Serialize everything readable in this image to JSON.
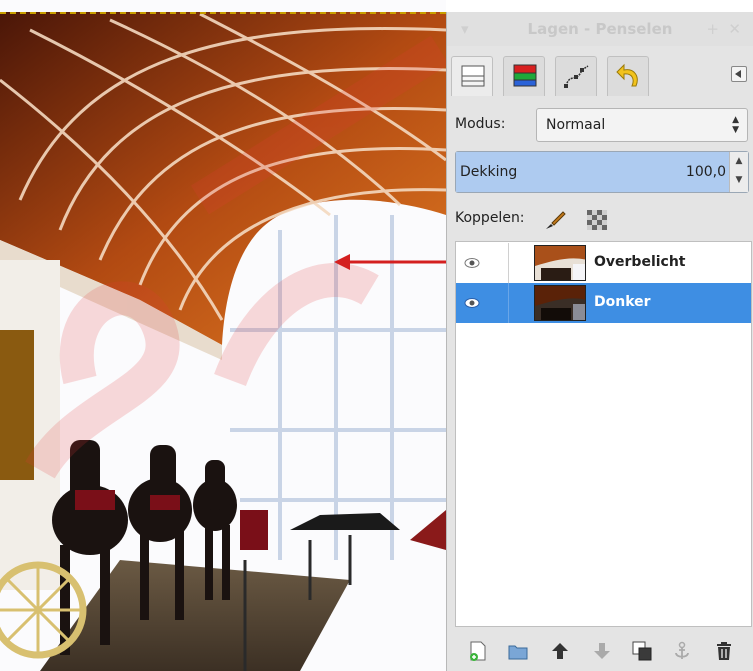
{
  "panel": {
    "title": "Lagen - Penselen",
    "tabs": [
      {
        "icon": "layers-icon",
        "active": true
      },
      {
        "icon": "channels-icon",
        "active": false
      },
      {
        "icon": "paths-icon",
        "active": false
      },
      {
        "icon": "undo-history-icon",
        "active": false
      }
    ],
    "mode_label": "Modus:",
    "mode_value": "Normaal",
    "opacity_label": "Dekking",
    "opacity_value": "100,0",
    "opacity_fraction": 1.0,
    "lock_label": "Koppelen:",
    "layers": [
      {
        "name": "Overbelicht",
        "visible": true,
        "selected": false
      },
      {
        "name": "Donker",
        "visible": true,
        "selected": true
      }
    ],
    "bottom_buttons": [
      "new-layer-icon",
      "new-layer-group-icon",
      "raise-layer-icon",
      "lower-layer-icon",
      "duplicate-layer-icon",
      "anchor-layer-icon",
      "delete-layer-icon"
    ]
  },
  "colors": {
    "selection": "#3e8ee3",
    "opacity_fill": "#aecbf0",
    "annotation_arrow": "#d42020"
  }
}
